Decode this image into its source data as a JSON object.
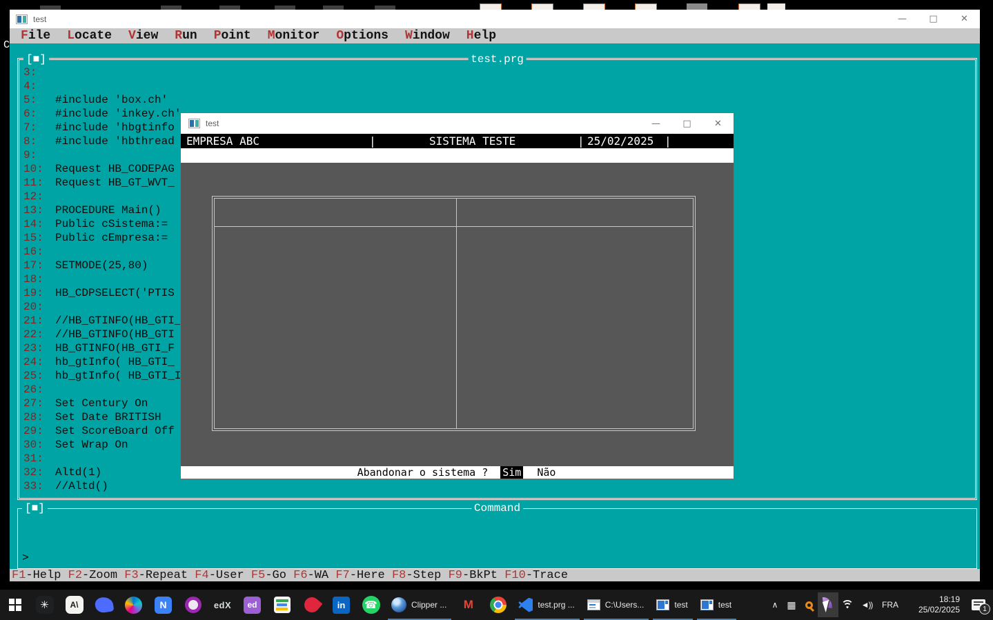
{
  "desktop": {
    "stray_char": "C"
  },
  "app_window": {
    "title": "test",
    "window_controls": {
      "minimize": "—",
      "maximize": "□",
      "close": "✕"
    },
    "menu_items": [
      "File",
      "Locate",
      "View",
      "Run",
      "Point",
      "Monitor",
      "Options",
      "Window",
      "Help"
    ],
    "source_panel": {
      "close_box": "[■]",
      "title": "test.prg",
      "lines": [
        {
          "num": "3:",
          "code": ""
        },
        {
          "num": "4:",
          "code": ""
        },
        {
          "num": "5:",
          "code": "#include 'box.ch'"
        },
        {
          "num": "6:",
          "code": "#include 'inkey.ch'"
        },
        {
          "num": "7:",
          "code": "#include 'hbgtinfo"
        },
        {
          "num": "8:",
          "code": "#include 'hbthread"
        },
        {
          "num": "9:",
          "code": ""
        },
        {
          "num": "10:",
          "code": "Request HB_CODEPAG"
        },
        {
          "num": "11:",
          "code": "Request HB_GT_WVT_"
        },
        {
          "num": "12:",
          "code": ""
        },
        {
          "num": "13:",
          "code": "PROCEDURE Main()"
        },
        {
          "num": "14:",
          "code": "Public cSistema:="
        },
        {
          "num": "15:",
          "code": "Public cEmpresa:="
        },
        {
          "num": "16:",
          "code": ""
        },
        {
          "num": "17:",
          "code": "SETMODE(25,80)"
        },
        {
          "num": "18:",
          "code": ""
        },
        {
          "num": "19:",
          "code": "HB_CDPSELECT('PTIS"
        },
        {
          "num": "20:",
          "code": ""
        },
        {
          "num": "21:",
          "code": "//HB_GTINFO(HB_GTI_"
        },
        {
          "num": "22:",
          "code": "//HB_GTINFO(HB_GTI"
        },
        {
          "num": "23:",
          "code": "HB_GTINFO(HB_GTI_F"
        },
        {
          "num": "24:",
          "code": "hb_gtInfo( HB_GTI_"
        },
        {
          "num": "25:",
          "code": "hb_gtInfo( HB_GTI_I"
        },
        {
          "num": "26:",
          "code": ""
        },
        {
          "num": "27:",
          "code": "Set Century On"
        },
        {
          "num": "28:",
          "code": "Set Date BRITISH"
        },
        {
          "num": "29:",
          "code": "Set ScoreBoard Off"
        },
        {
          "num": "30:",
          "code": "Set Wrap On"
        },
        {
          "num": "31:",
          "code": ""
        },
        {
          "num": "32:",
          "code": "Altd(1)"
        },
        {
          "num": "33:",
          "code": "//Altd()"
        }
      ]
    },
    "command_panel": {
      "close_box": "[■]",
      "title": "Command",
      "prompt": ">"
    },
    "fkeys": [
      {
        "key": "F1",
        "label": "-Help "
      },
      {
        "key": "F2",
        "label": "-Zoom "
      },
      {
        "key": "F3",
        "label": "-Repeat "
      },
      {
        "key": "F4",
        "label": "-User "
      },
      {
        "key": "F5",
        "label": "-Go "
      },
      {
        "key": "F6",
        "label": "-WA "
      },
      {
        "key": "F7",
        "label": "-Here "
      },
      {
        "key": "F8",
        "label": "-Step "
      },
      {
        "key": "F9",
        "label": "-BkPt "
      },
      {
        "key": "F10",
        "label": "-Trace"
      }
    ]
  },
  "program_window": {
    "title": "test",
    "window_controls": {
      "minimize": "—",
      "maximize": "□",
      "close": "✕"
    },
    "header": {
      "company": "EMPRESA ABC",
      "separator": "|",
      "system": "SISTEMA TESTE",
      "date": "25/02/2025"
    },
    "dialog": {
      "question": "Abandonar o sistema ?",
      "yes": "Sim",
      "no": "Não"
    }
  },
  "taskbar": {
    "icon_glyphs": {
      "chatgpt": "✳",
      "claude": "A\\",
      "notion": "N",
      "edx": "edX",
      "ed": "ed",
      "linkedin": "in",
      "whatsapp": "☎",
      "gmail": "M"
    },
    "buttons": {
      "clipper": "Clipper ...",
      "vscode": "test.prg ...",
      "console": "C:\\Users...",
      "test1": "test",
      "test2": "test"
    },
    "tray": {
      "speaker": "◄))",
      "language": "FRA",
      "time": "18:19",
      "date": "25/02/2025",
      "badge": "1"
    }
  },
  "colors": {
    "teal": "#00A4A4",
    "chrome_gray": "#C9C9C9",
    "hotkey_red": "#B23434",
    "line_number_red": "#8C1E1E",
    "panel_gray": "#575757",
    "active_underline": "#4883B8"
  }
}
